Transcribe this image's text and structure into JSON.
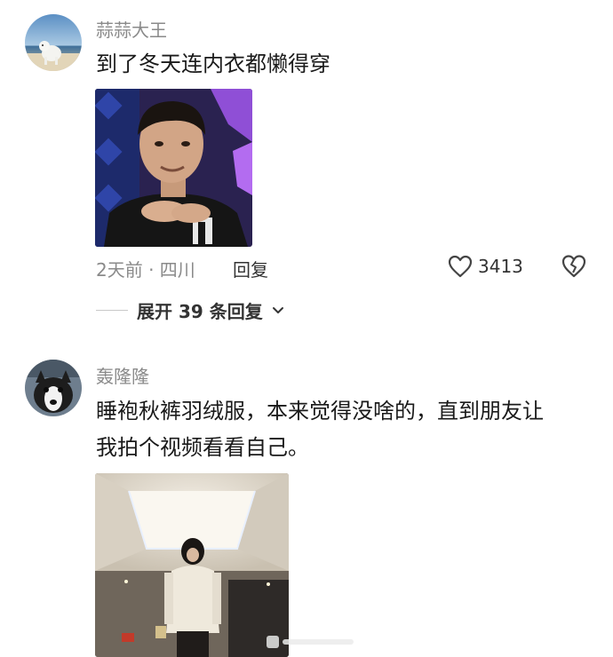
{
  "comments": [
    {
      "username": "蒜蒜大王",
      "text": "到了冬天连内衣都懒得穿",
      "meta": "2天前 · 四川",
      "reply_label": "回复",
      "likes": "3413",
      "expand_label": "展开 39 条回复"
    },
    {
      "username": "轰隆隆",
      "text_line1": "睡袍秋裤羽绒服，本来觉得没啥的，直到朋友让",
      "text_line2": "我拍个视频看看自己。"
    }
  ],
  "colors": {
    "username": "#8a8a8a",
    "text": "#1a1a1a",
    "action": "#333333",
    "background": "#ffffff"
  },
  "icons": {
    "like": "heart-outline-icon",
    "dislike": "broken-heart-icon",
    "expand": "chevron-down-icon"
  }
}
